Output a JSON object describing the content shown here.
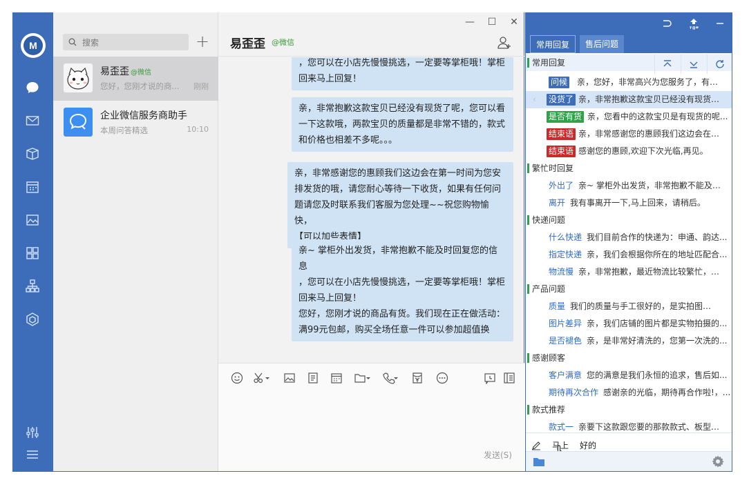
{
  "sidebar": {
    "logo_text": "M",
    "icons": [
      "chat-icon",
      "mail-icon",
      "box-icon",
      "calendar-icon",
      "photo-icon",
      "apps-icon",
      "org-icon",
      "cube-icon",
      "settings-sliders-icon",
      "menu-icon"
    ]
  },
  "contacts": {
    "search_placeholder": "搜索",
    "add_label": "+",
    "items": [
      {
        "name": "易歪歪",
        "tag": "@微信",
        "preview": "您好，您刚才说的商...",
        "time": "刚刚"
      },
      {
        "name": "企业微信服务商助手",
        "tag": "",
        "preview": "本周问答精选",
        "time": "10:10"
      }
    ]
  },
  "chat": {
    "title": "易歪歪",
    "source": "@微信",
    "window_controls": {
      "minimize": "—",
      "maximize": "☐",
      "close": "✕"
    },
    "messages": [
      {
        "lines": [
          "，您可以在小店先慢慢挑选，一定要等掌柜哦！掌柜",
          "回来马上回复！"
        ]
      },
      {
        "lines": [
          "亲，非常抱歉这款宝贝已经没有现货了呢，您可以看",
          "一下这款哦，两款宝贝的质量都是非常不错的，款式",
          "和价格也相差不多呢。。。"
        ]
      },
      {
        "lines": [
          "亲，非常感谢您的惠顾我们这边会在第一时间为您安",
          "排发货的哦，请您耐心等待一下收货，如果有任何问",
          "题请您及时联系我们客服为您处理~~祝您购物愉快，",
          "【可以加些表情】"
        ]
      },
      {
        "lines": [
          "亲~ 掌柜外出发货，非常抱歉不能及时回复您的信息",
          "，您可以在小店先慢慢挑选，一定要等掌柜哦！掌柜",
          "回来马上回复！"
        ]
      },
      {
        "lines": [
          "您好，您刚才说的商品有货。我们现在正在做活动：",
          "满99元包邮，购买全场任意一件可以参加超值换"
        ]
      }
    ],
    "send_label": "发送(S)"
  },
  "quick_reply": {
    "tabs": [
      "常用回复",
      "售后问题"
    ],
    "groups": [
      {
        "title": "常用回复",
        "rows": [
          {
            "kw": "问候",
            "style": "blue",
            "text": "亲，您好，非常高兴为您服务了，有什么..."
          },
          {
            "kw": "没货了",
            "style": "blue",
            "text": "亲，非常抱歉这款宝贝已经没有现货了..."
          },
          {
            "kw": "是否有货",
            "style": "green",
            "text": "亲，您看中的这款宝贝是有现货的呢..."
          },
          {
            "kw": "结束语",
            "style": "red",
            "text": "亲，非常感谢您的惠顾我们这边会在第..."
          },
          {
            "kw": "结束语",
            "style": "red",
            "text": "感谢您的惠顾,欢迎下次光临,再见。"
          }
        ]
      },
      {
        "title": "繁忙时回复",
        "rows": [
          {
            "kw": "外出了",
            "style": "link",
            "text": "亲~ 掌柜外出发货，非常抱歉不能及时..."
          },
          {
            "kw": "离开",
            "style": "link",
            "text": "我有事离开一下,马上回来，请稍后。"
          }
        ]
      },
      {
        "title": "快递问题",
        "rows": [
          {
            "kw": "什么快递",
            "style": "link",
            "text": "我们目前合作的快递为：申通、韵达..."
          },
          {
            "kw": "指定快递",
            "style": "link",
            "text": "亲，我们会根据你所在的地址匹配合..."
          },
          {
            "kw": "物流慢",
            "style": "link",
            "text": "亲，非常抱歉，最近物流比较繁忙，发..."
          }
        ]
      },
      {
        "title": "产品问题",
        "rows": [
          {
            "kw": "质量",
            "style": "link",
            "text": "我们的质量与手工很好的，是实拍图，请..."
          },
          {
            "kw": "图片差异",
            "style": "link",
            "text": "亲，我们店铺的图片都是实物拍摄的..."
          },
          {
            "kw": "是否褪色",
            "style": "link",
            "text": "亲，是非常好清洗的，您第一次洗的..."
          }
        ]
      },
      {
        "title": "感谢顾客",
        "rows": [
          {
            "kw": "客户满意",
            "style": "link",
            "text": "您的满意是我们永恒的追求，售后如..."
          },
          {
            "kw": "期待再次合作",
            "style": "link",
            "text": "感谢亲的光临，期待再合作啦!，..."
          }
        ]
      },
      {
        "title": "款式推荐",
        "rows": [
          {
            "kw": "款式一",
            "style": "link",
            "text": "亲要下这款跟您要的那款款式、板型上..."
          }
        ]
      }
    ],
    "footer": {
      "quick_a": "马上",
      "quick_b": "好的"
    }
  }
}
